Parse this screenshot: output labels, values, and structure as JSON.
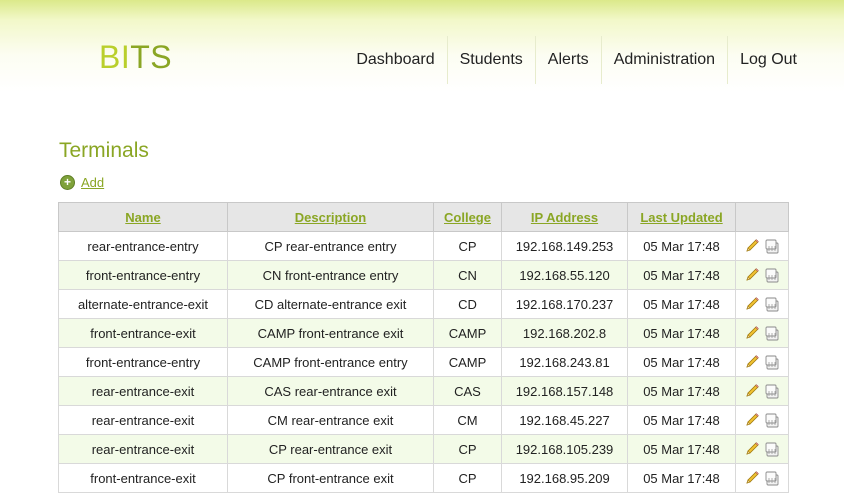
{
  "app": {
    "logo_part1": "BI",
    "logo_part2": "TS",
    "nav": [
      "Dashboard",
      "Students",
      "Alerts",
      "Administration",
      "Log Out"
    ]
  },
  "page": {
    "title": "Terminals",
    "add_label": "Add"
  },
  "table": {
    "columns": [
      "Name",
      "Description",
      "College",
      "IP Address",
      "Last Updated"
    ],
    "rows": [
      {
        "name": "rear-entrance-entry",
        "description": "CP rear-entrance entry",
        "college": "CP",
        "ip": "192.168.149.253",
        "updated": "05 Mar 17:48"
      },
      {
        "name": "front-entrance-entry",
        "description": "CN front-entrance entry",
        "college": "CN",
        "ip": "192.168.55.120",
        "updated": "05 Mar 17:48"
      },
      {
        "name": "alternate-entrance-exit",
        "description": "CD alternate-entrance exit",
        "college": "CD",
        "ip": "192.168.170.237",
        "updated": "05 Mar 17:48"
      },
      {
        "name": "front-entrance-exit",
        "description": "CAMP front-entrance exit",
        "college": "CAMP",
        "ip": "192.168.202.8",
        "updated": "05 Mar 17:48"
      },
      {
        "name": "front-entrance-entry",
        "description": "CAMP front-entrance entry",
        "college": "CAMP",
        "ip": "192.168.243.81",
        "updated": "05 Mar 17:48"
      },
      {
        "name": "rear-entrance-exit",
        "description": "CAS rear-entrance exit",
        "college": "CAS",
        "ip": "192.168.157.148",
        "updated": "05 Mar 17:48"
      },
      {
        "name": "rear-entrance-exit",
        "description": "CM rear-entrance exit",
        "college": "CM",
        "ip": "192.168.45.227",
        "updated": "05 Mar 17:48"
      },
      {
        "name": "rear-entrance-exit",
        "description": "CP rear-entrance exit",
        "college": "CP",
        "ip": "192.168.105.239",
        "updated": "05 Mar 17:48"
      },
      {
        "name": "front-entrance-exit",
        "description": "CP front-entrance exit",
        "college": "CP",
        "ip": "192.168.95.209",
        "updated": "05 Mar 17:48"
      }
    ],
    "row_actions": [
      "edit-icon",
      "delete-icon"
    ]
  },
  "colors": {
    "brand_light": "#b9cf2c",
    "brand": "#8aa624",
    "row_alt": "#f3fbe8",
    "header_bg": "#e6e6e6"
  }
}
